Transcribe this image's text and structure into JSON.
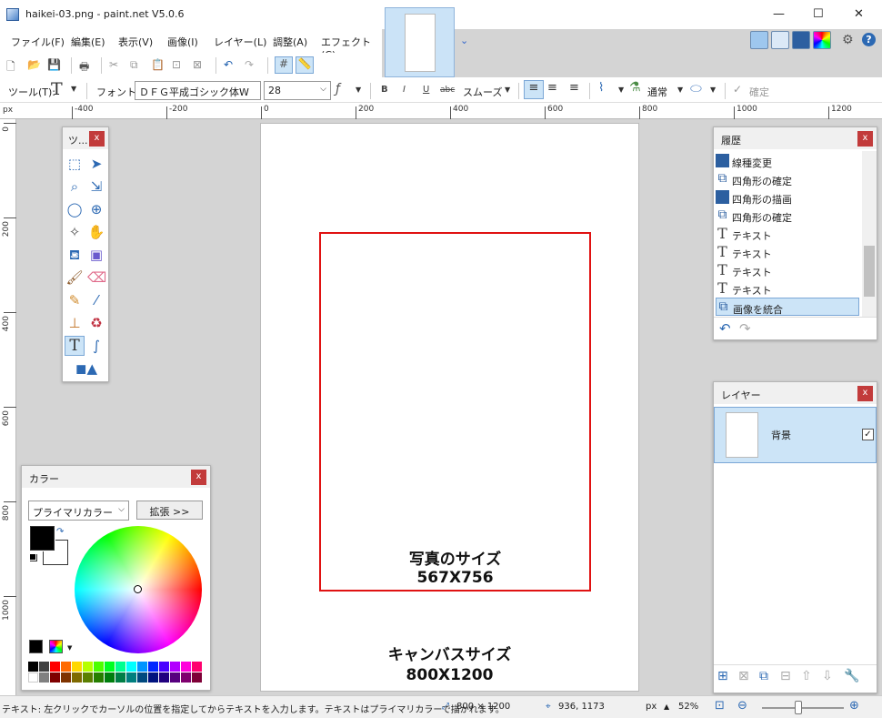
{
  "window": {
    "title": "haikei-03.png - paint.net V5.0.6",
    "minimize": "—",
    "maximize": "☐",
    "close": "✕"
  },
  "menu": [
    {
      "label": "ファイル(F)"
    },
    {
      "label": "編集(E)"
    },
    {
      "label": "表示(V)"
    },
    {
      "label": "画像(I)"
    },
    {
      "label": "レイヤー(L)"
    },
    {
      "label": "調整(A)"
    },
    {
      "label": "エフェクト(C)"
    }
  ],
  "thumbnail": {
    "chevron": "⌄"
  },
  "toolbar2": {
    "tool_label": "ツール(T):",
    "font_label": "フォント:",
    "font_value": "ＤＦＧ平成ゴシック体W",
    "size_value": "28",
    "bold": "B",
    "italic": "I",
    "underline": "U",
    "strike": "abc",
    "antialias": "スムーズ",
    "blend": "通常",
    "commit": "確定"
  },
  "ruler": {
    "unit": "px",
    "h_ticks": [
      "-400",
      "-200",
      "0",
      "200",
      "400",
      "600",
      "800",
      "1000",
      "1200"
    ],
    "v_ticks": [
      "0",
      "200",
      "400",
      "600",
      "800",
      "1000"
    ]
  },
  "canvas_text": {
    "photo_title": "写真のサイズ",
    "photo_size": "567X756",
    "canvas_title": "キャンバスサイズ",
    "canvas_size": "800X1200"
  },
  "tools_panel": {
    "title": "ツ..."
  },
  "history_panel": {
    "title": "履歴",
    "items": [
      {
        "label": "線種変更",
        "icon": "rect-fill-icon"
      },
      {
        "label": "四角形の確定",
        "icon": "rect-commit-icon"
      },
      {
        "label": "四角形の描画",
        "icon": "rect-fill-icon"
      },
      {
        "label": "四角形の確定",
        "icon": "rect-commit-icon"
      },
      {
        "label": "テキスト",
        "icon": "text-icon"
      },
      {
        "label": "テキスト",
        "icon": "text-icon"
      },
      {
        "label": "テキスト",
        "icon": "text-icon"
      },
      {
        "label": "テキスト",
        "icon": "text-icon"
      },
      {
        "label": "画像を統合",
        "icon": "flatten-icon"
      }
    ]
  },
  "layers_panel": {
    "title": "レイヤー",
    "layer_name": "背景"
  },
  "colors_panel": {
    "title": "カラー",
    "mode": "プライマリカラー",
    "expand": "拡張 >>",
    "primary": "#000000",
    "secondary": "#ffffff"
  },
  "status": {
    "hint": "テキスト: 左クリックでカーソルの位置を指定してからテキストを入力します。テキストはプライマリカラーで描かれます。",
    "image_size": "800 × 1200",
    "cursor_pos": "936, 1173",
    "unit": "px",
    "zoom": "52%"
  },
  "colors": {
    "accent": "#0078d7",
    "selection": "#cce4f7",
    "red_frame": "#e01212"
  }
}
